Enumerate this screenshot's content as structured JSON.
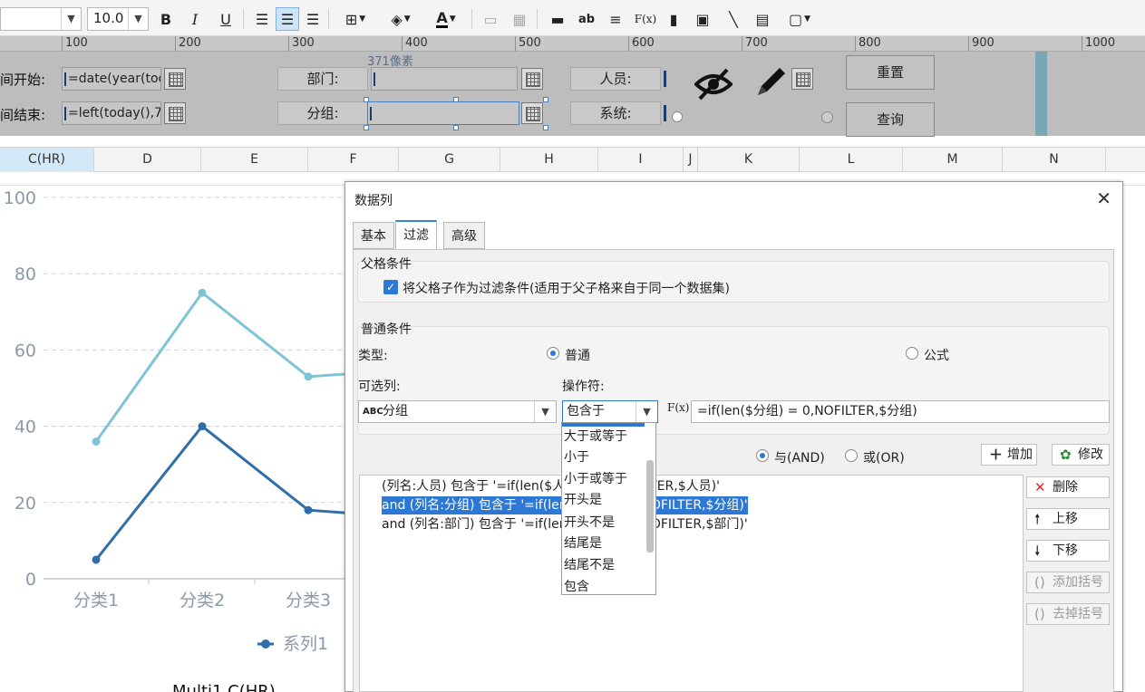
{
  "toolbar": {
    "font_size": "10.0",
    "bold_label": "B",
    "italic_label": "I",
    "underline_label": "U",
    "text_label": "ab",
    "formula_label": "F(x)",
    "font_color_label": "A",
    "icons": [
      "bold-icon",
      "italic-icon",
      "underline-icon",
      "align-left-icon",
      "align-center-icon",
      "align-right-icon",
      "border-icon",
      "fill-color-icon",
      "font-color-icon",
      "merge-icon",
      "grid-icon",
      "text-icon",
      "ab-icon",
      "paragraph-icon",
      "formula-icon",
      "bar-chart-icon",
      "image-icon",
      "slash-icon",
      "report-icon",
      "frame-icon"
    ]
  },
  "ruler": [
    "100",
    "200",
    "300",
    "400",
    "500",
    "600",
    "700",
    "800",
    "900",
    "1000"
  ],
  "param_pane": {
    "px_tag": "371像素",
    "start_label": "间开始:",
    "start_value": "=date(year(toda",
    "end_label": "间结束:",
    "end_value": "=left(today(),7)",
    "dept_label": "部门:",
    "group_label": "分组:",
    "person_label": "人员:",
    "system_label": "系统:",
    "reset_button": "重置",
    "query_button": "查询"
  },
  "columns": [
    "C(HR)",
    "D",
    "E",
    "F",
    "G",
    "H",
    "I",
    "J",
    "K",
    "L",
    "M",
    "N"
  ],
  "chart_data": {
    "type": "line",
    "categories": [
      "分类1",
      "分类2",
      "分类3",
      "分类4"
    ],
    "ylim": [
      0,
      100
    ],
    "yticks": [
      "0",
      "20",
      "40",
      "60",
      "80",
      "100"
    ],
    "series": [
      {
        "values": [
          36,
          75,
          53,
          55
        ],
        "color": "#7ec4d6"
      },
      {
        "name": "系列1",
        "values": [
          5,
          40,
          18,
          16
        ],
        "color": "#2f6ea8"
      }
    ],
    "legend": "bottom",
    "caption": "Multi1 C(HR)"
  },
  "dialog": {
    "title": "数据列",
    "tabs": [
      "基本",
      "过滤",
      "高级"
    ],
    "parent_group_title": "父格条件",
    "parent_checkbox_label": "将父格子作为过滤条件(适用于父子格来自于同一个数据集)",
    "normal_group_title": "普通条件",
    "type_label": "类型:",
    "radio_normal": "普通",
    "radio_formula": "公式",
    "column_label": "可选列:",
    "operator_label": "操作符:",
    "column_value": "分组",
    "operator_value": "包含于",
    "formula_value": "=if(len($分组) = 0,NOFILTER,$分组)",
    "and_label": "与(AND)",
    "or_label": "或(OR)",
    "add_button": "增加",
    "modify_button": "修改",
    "conditions": [
      "(列名:人员) 包含于 '=if(len($人员) = 0,NOFILTER,$人员)'",
      "and (列名:分组) 包含于 '=if(len($分组) = 0,NOFILTER,$分组)'",
      "and (列名:部门) 包含于 '=if(len($部门) = 0,NOFILTER,$部门)'"
    ],
    "side_buttons": [
      "删除",
      "上移",
      "下移",
      "添加括号",
      "去掉括号"
    ],
    "operator_options": [
      "大于或等于",
      "小于",
      "小于或等于",
      "开头是",
      "开头不是",
      "结尾是",
      "结尾不是",
      "包含"
    ]
  }
}
